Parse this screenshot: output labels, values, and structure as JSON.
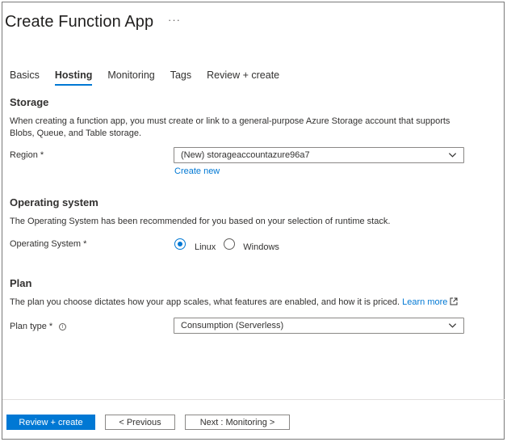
{
  "header": {
    "title": "Create Function App",
    "more": "···"
  },
  "tabs": [
    {
      "label": "Basics",
      "active": false
    },
    {
      "label": "Hosting",
      "active": true
    },
    {
      "label": "Monitoring",
      "active": false
    },
    {
      "label": "Tags",
      "active": false
    },
    {
      "label": "Review + create",
      "active": false
    }
  ],
  "storage": {
    "heading": "Storage",
    "description": "When creating a function app, you must create or link to a general-purpose Azure Storage account that supports Blobs, Queue, and Table storage.",
    "region_label": "Region *",
    "region_value": "(New) storageaccountazure96a7",
    "create_new": "Create new"
  },
  "os": {
    "heading": "Operating system",
    "description": "The Operating System has been recommended for you based on your selection of runtime stack.",
    "label": "Operating System *",
    "options": [
      {
        "label": "Linux",
        "checked": true
      },
      {
        "label": "Windows",
        "checked": false
      }
    ]
  },
  "plan": {
    "heading": "Plan",
    "description": "The plan you choose dictates how your app scales, what features are enabled, and how it is priced.",
    "learn_more": "Learn more",
    "type_label": "Plan type *",
    "type_value": "Consumption (Serverless)"
  },
  "footer": {
    "review_create": "Review + create",
    "previous": "< Previous",
    "next": "Next : Monitoring >"
  },
  "colors": {
    "accent": "#0078d4",
    "text": "#323130",
    "border": "#8a8886"
  },
  "icons": [
    "more-icon",
    "chevron-down-icon",
    "external-link-icon",
    "info-icon"
  ]
}
